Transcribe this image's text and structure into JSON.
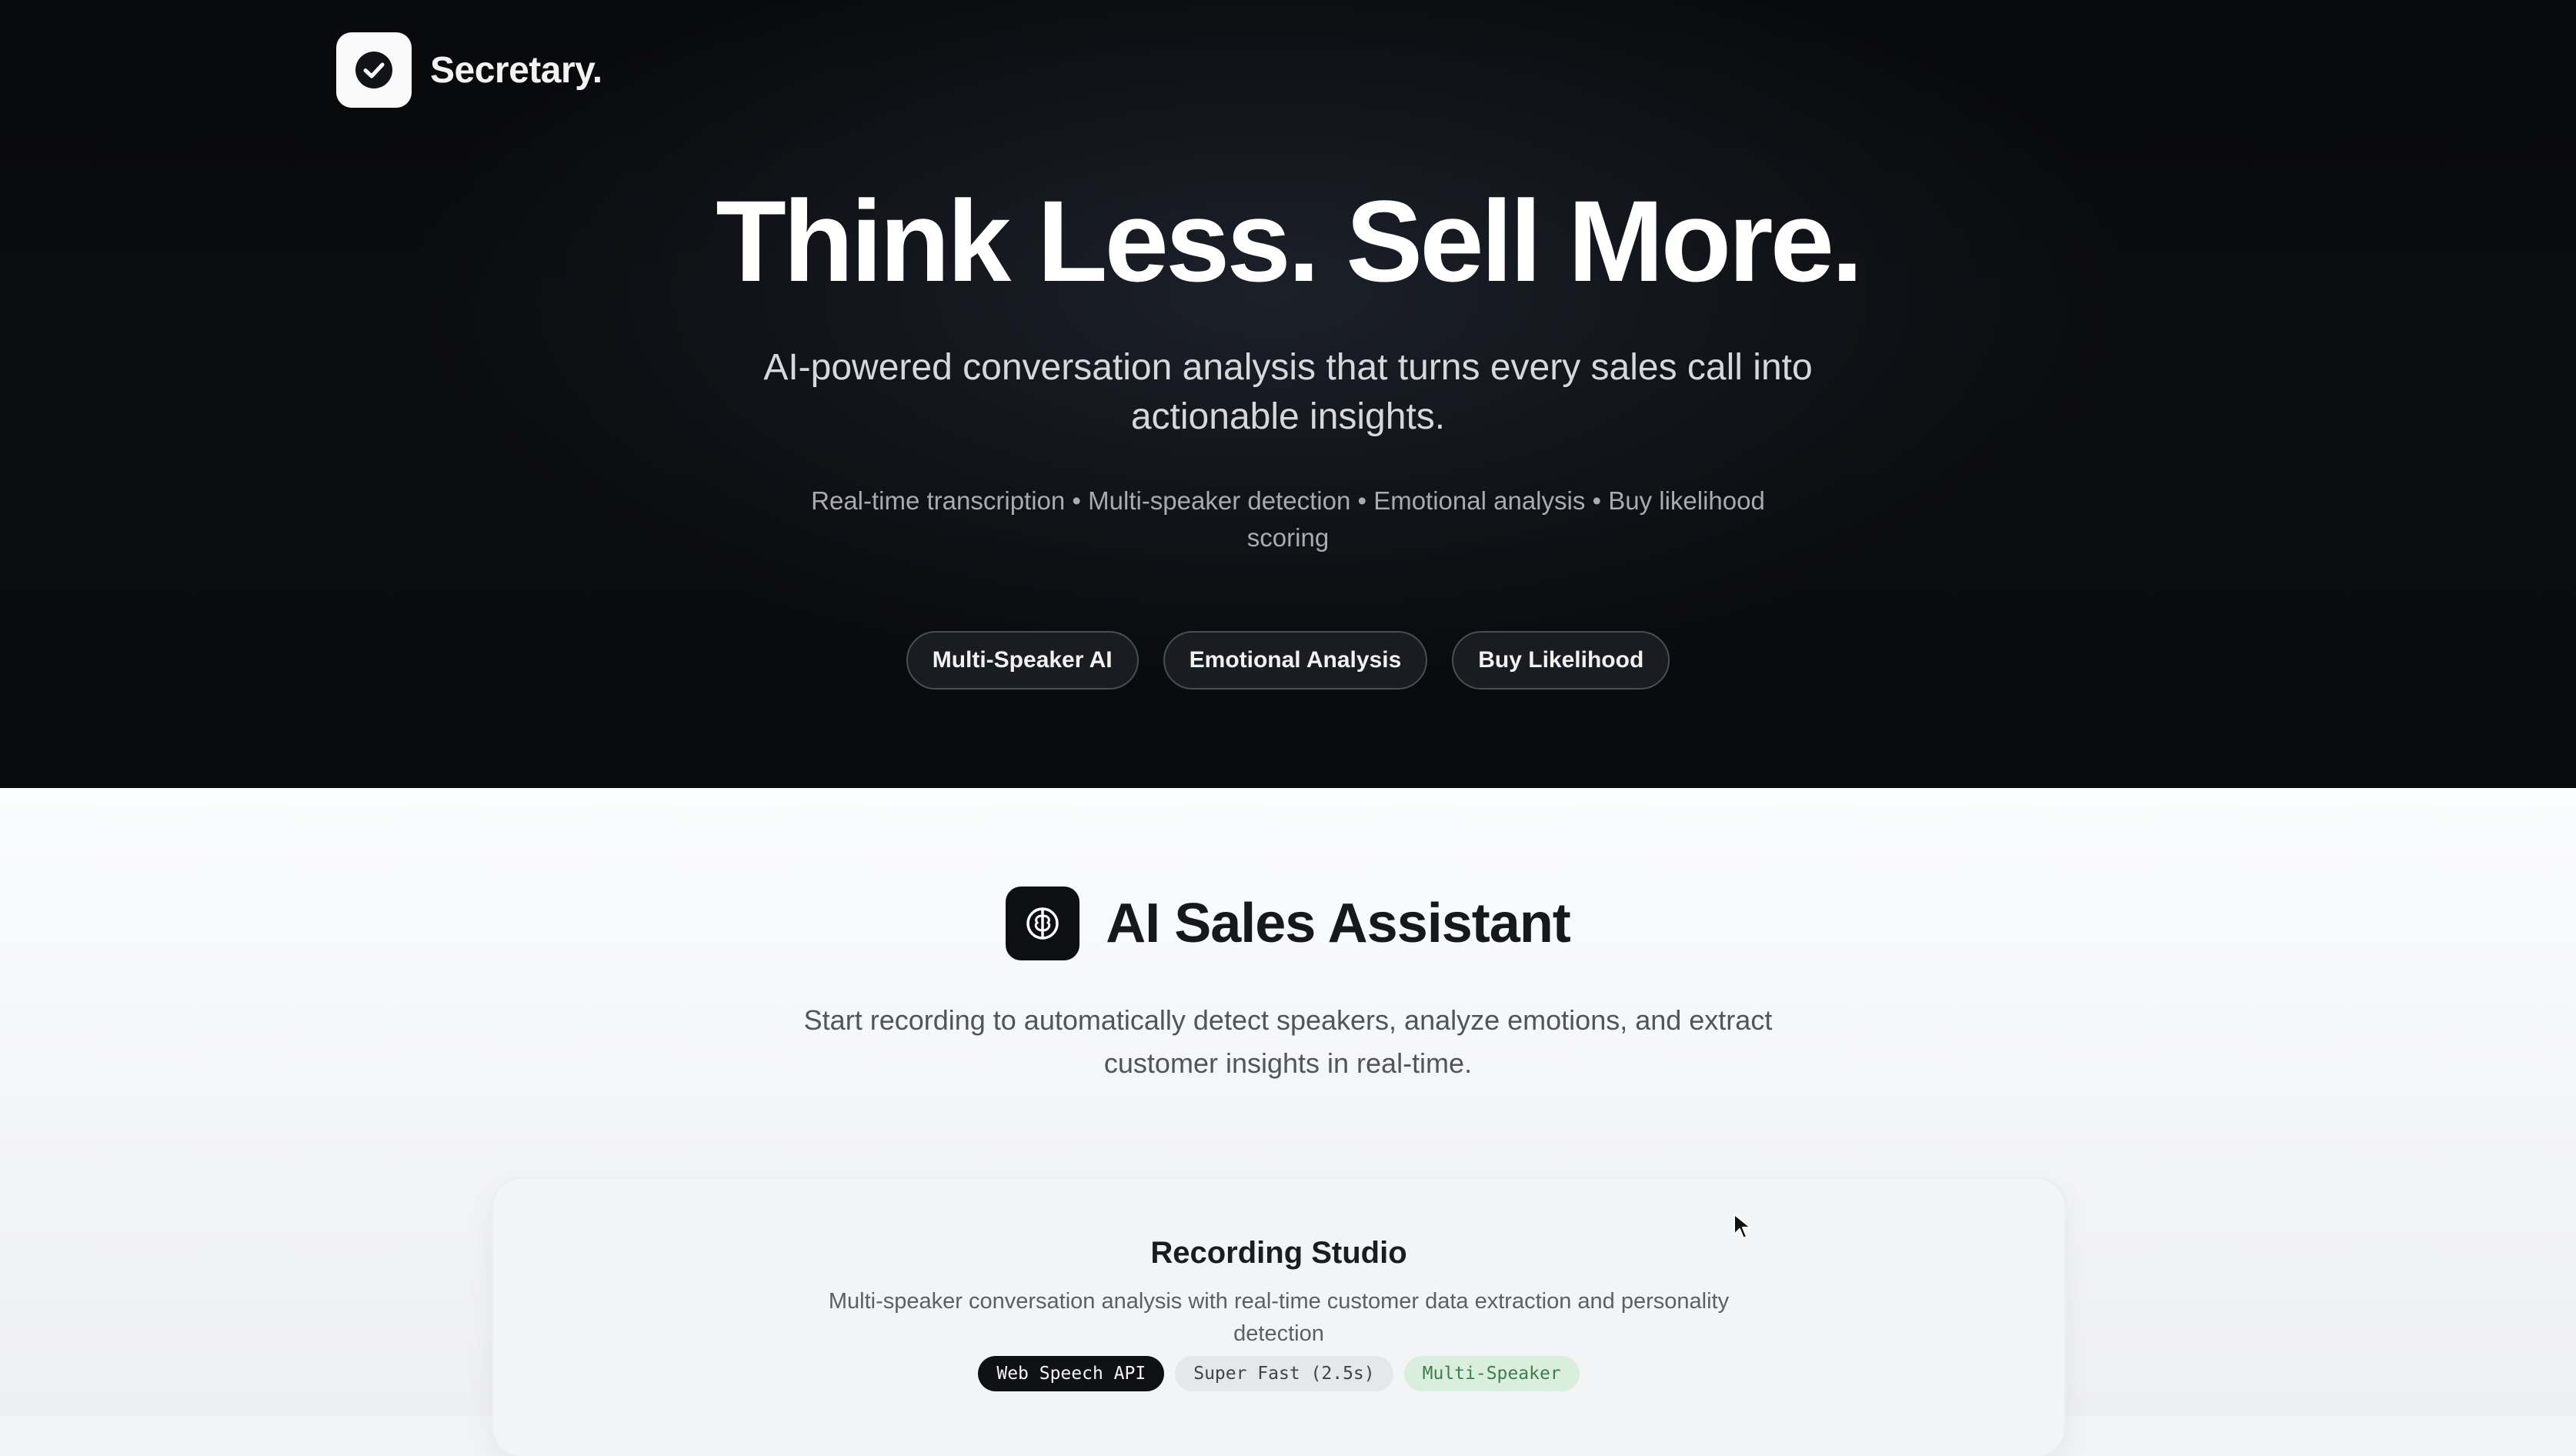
{
  "brand": {
    "name": "Secretary."
  },
  "hero": {
    "title": "Think Less. Sell More.",
    "subtitle": "AI-powered conversation analysis that turns every sales call into actionable insights.",
    "features": "Real-time transcription • Multi-speaker detection • Emotional analysis • Buy likelihood scoring",
    "pills": [
      "Multi-Speaker AI",
      "Emotional Analysis",
      "Buy Likelihood"
    ]
  },
  "assistant": {
    "title": "AI Sales Assistant",
    "description": "Start recording to automatically detect speakers, analyze emotions, and extract customer insights in real-time."
  },
  "studio": {
    "title": "Recording Studio",
    "description": "Multi-speaker conversation analysis with real-time customer data extraction and personality detection",
    "tags": [
      "Web Speech API",
      "Super Fast (2.5s)",
      "Multi-Speaker"
    ]
  },
  "icons": {
    "logo": "check-circle-icon",
    "section": "brain-icon",
    "cursor": "mouse-pointer-icon"
  }
}
